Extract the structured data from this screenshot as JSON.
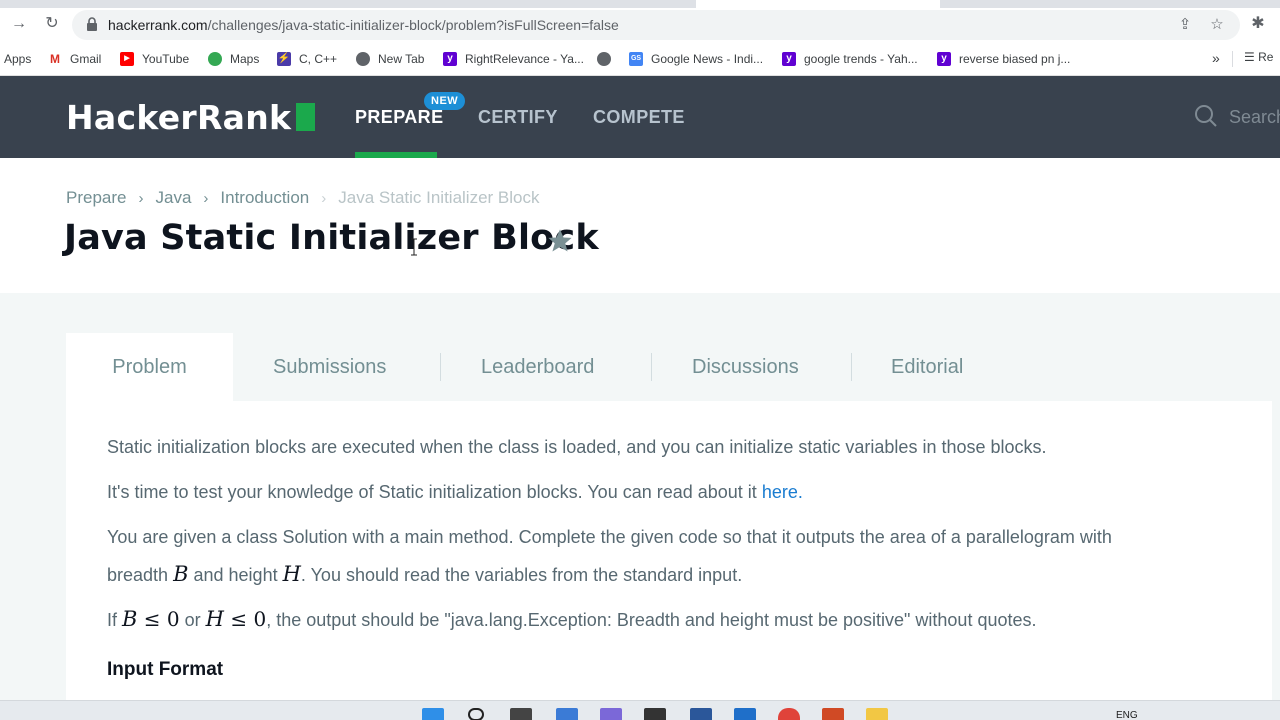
{
  "browser": {
    "url_domain": "hackerrank.com",
    "url_path": "/challenges/java-static-initializer-block/problem?isFullScreen=false",
    "bookmarks": [
      {
        "label": "Apps",
        "icon": "apps-grid-icon"
      },
      {
        "label": "Gmail",
        "icon": "gmail-icon"
      },
      {
        "label": "YouTube",
        "icon": "youtube-icon"
      },
      {
        "label": "Maps",
        "icon": "maps-icon"
      },
      {
        "label": "C, C++",
        "icon": "lightning-icon"
      },
      {
        "label": "New Tab",
        "icon": "globe-icon"
      },
      {
        "label": "RightRelevance - Ya...",
        "icon": "yahoo-icon"
      },
      {
        "label": "Google News - Indi...",
        "icon": "google-news-icon"
      },
      {
        "label": "google trends - Yah...",
        "icon": "yahoo-icon"
      },
      {
        "label": "reverse biased pn j...",
        "icon": "yahoo-icon"
      }
    ],
    "more_bookmarks": "»",
    "reading_list": "Re"
  },
  "header": {
    "logo": "HackerRank",
    "nav": [
      {
        "label": "PREPARE",
        "active": true
      },
      {
        "label": "CERTIFY",
        "active": false
      },
      {
        "label": "COMPETE",
        "active": false
      }
    ],
    "new_badge": "NEW",
    "search_placeholder": "Search"
  },
  "breadcrumb": [
    "Prepare",
    "Java",
    "Introduction",
    "Java Static Initializer Block"
  ],
  "page_title": "Java Static Initializer Block",
  "tabs": [
    "Problem",
    "Submissions",
    "Leaderboard",
    "Discussions",
    "Editorial"
  ],
  "problem": {
    "p1": "Static initialization blocks are executed when the class is loaded, and you can initialize static variables in those blocks.",
    "p2_text": "It's time to test your knowledge of Static initialization blocks. You can read about it ",
    "p2_link": "here.",
    "p3_line1": "You are given a class Solution with a main method. Complete the given code so that it outputs the area of a parallelogram with",
    "p3_l2_a": "breadth ",
    "p3_l2_var1": "B",
    "p3_l2_b": " and height ",
    "p3_l2_var2": "H",
    "p3_l2_c": ". You should read the variables from the standard input.",
    "p4_a": "If ",
    "p4_var1": "B",
    "p4_le1": " ≤ 0",
    "p4_or": " or ",
    "p4_var2": "H",
    "p4_le2": " ≤ 0",
    "p4_rest": ", the output should be \"java.lang.Exception: Breadth and height must be positive\" without quotes.",
    "input_format": "Input Format"
  },
  "taskbar": {
    "lang": "ENG"
  },
  "colors": {
    "header_bg": "#39424e",
    "brand_green": "#1ba94c",
    "link_blue": "#1a7cd0",
    "badge_blue": "#1d8fd6"
  }
}
